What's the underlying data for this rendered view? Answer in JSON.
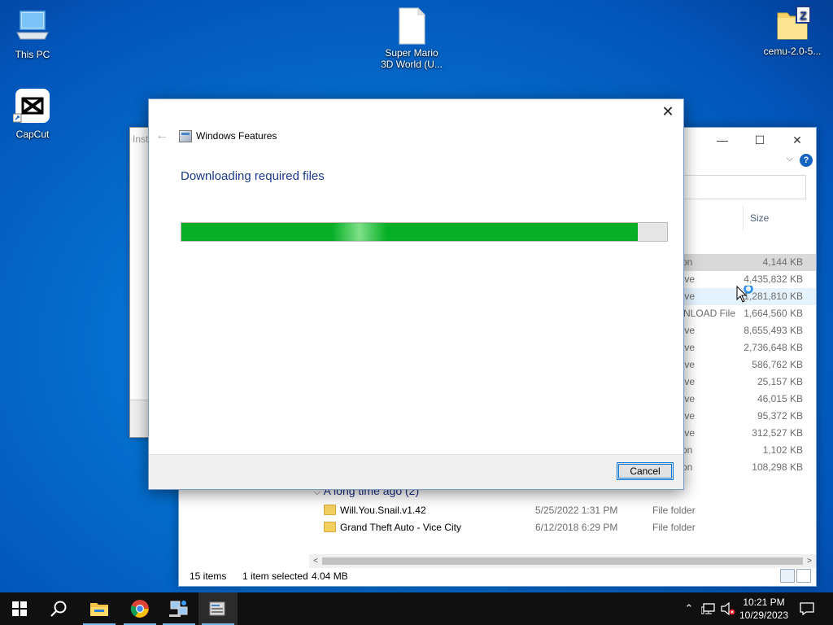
{
  "desktop": {
    "icons": [
      {
        "label": "This PC",
        "icon": "this-pc-icon"
      },
      {
        "label": "CapCut",
        "icon": "capcut-icon"
      },
      {
        "label": "Super Mario 3D World (U...",
        "icon": "document-icon"
      },
      {
        "label": "cemu-2.0-5...",
        "icon": "zip-folder-icon"
      }
    ]
  },
  "installer_window": {
    "title": "Insta"
  },
  "dialog": {
    "title": "Windows Features",
    "heading": "Downloading required files",
    "progress": 0.94,
    "cancel_label": "Cancel",
    "close_symbol": "✕",
    "back_symbol": "←"
  },
  "explorer": {
    "column_size": "Size",
    "rows": [
      {
        "type": "tion",
        "size": "4,144 KB"
      },
      {
        "type": "hive",
        "size": "4,435,832 KB"
      },
      {
        "type": "hive",
        "size": "1,281,810 KB"
      },
      {
        "type": "VNLOAD File",
        "size": "1,664,560 KB"
      },
      {
        "type": "hive",
        "size": "8,655,493 KB"
      },
      {
        "type": "hive",
        "size": "2,736,648 KB"
      },
      {
        "type": "hive",
        "size": "586,762 KB"
      },
      {
        "type": "hive",
        "size": "25,157 KB"
      },
      {
        "type": "hive",
        "size": "46,015 KB"
      },
      {
        "type": "hive",
        "size": "95,372 KB"
      },
      {
        "type": "hive",
        "size": "312,527 KB"
      },
      {
        "type": "tion",
        "size": "1,102 KB"
      },
      {
        "type": "tion",
        "size": "108,298 KB"
      }
    ],
    "group_header": "A long time ago (2)",
    "folders": [
      {
        "name": "Will.You.Snail.v1.42",
        "date": "5/25/2022 1:31 PM",
        "type": "File folder"
      },
      {
        "name": "Grand Theft Auto - Vice City",
        "date": "6/12/2018 6:29 PM",
        "type": "File folder"
      }
    ],
    "status": {
      "items": "15 items",
      "selected": "1 item selected",
      "size": "4.04 MB"
    }
  },
  "taskbar": {
    "clock_time": "10:21 PM",
    "clock_date": "10/29/2023"
  },
  "colors": {
    "progress_green": "#06b025",
    "heading_blue": "#1c3a8a",
    "taskbar": "#101010",
    "accent": "#0078d7"
  }
}
